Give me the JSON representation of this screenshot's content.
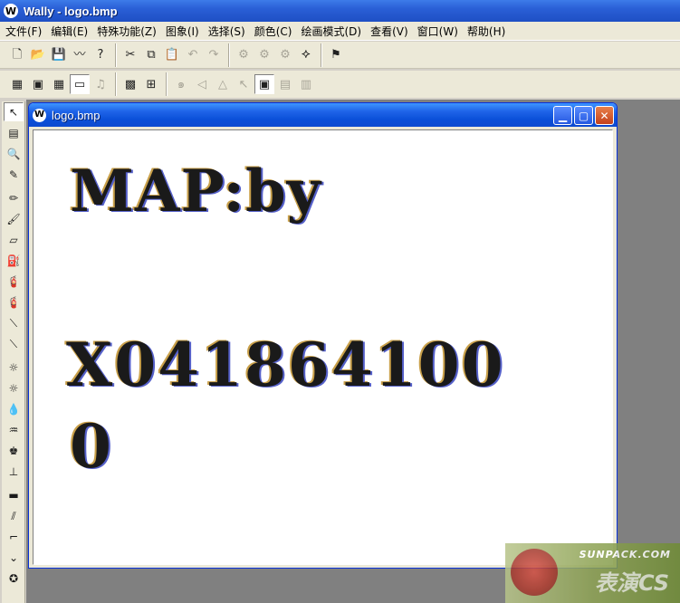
{
  "window": {
    "title": "Wally - logo.bmp",
    "app_icon_glyph": "W"
  },
  "menu": [
    {
      "label": "文件(F)"
    },
    {
      "label": "编辑(E)"
    },
    {
      "label": "特殊功能(Z)"
    },
    {
      "label": "图象(I)"
    },
    {
      "label": "选择(S)"
    },
    {
      "label": "颜色(C)"
    },
    {
      "label": "绘画模式(D)"
    },
    {
      "label": "查看(V)"
    },
    {
      "label": "窗口(W)"
    },
    {
      "label": "帮助(H)"
    }
  ],
  "toolbar1": {
    "icons": [
      "new-file-icon",
      "open-folder-icon",
      "save-disk-icon",
      "wand-icon",
      "help-icon",
      "cut-icon",
      "copy-icon",
      "paste-icon",
      "undo-icon",
      "redo-icon",
      "entity-icon",
      "entity2-icon",
      "entity3-icon",
      "decal-icon",
      "compile-icon"
    ],
    "glyphs": [
      "🗋",
      "📂",
      "💾",
      "〰",
      "?",
      "✂",
      "⧉",
      "📋",
      "↶",
      "↷",
      "⚙",
      "⚙",
      "⚙",
      "⯎",
      "⚑"
    ]
  },
  "toolbar2": {
    "icons": [
      "palette-icon",
      "image-icon",
      "grid-icon",
      "tile-icon",
      "music-icon",
      "grid-dense-icon",
      "grid-quad-icon",
      "spiral-icon",
      "triangle-left-icon",
      "triangle-icon",
      "arrow-icon",
      "layout1-icon",
      "layout2-icon",
      "layout3-icon"
    ],
    "glyphs": [
      "▦",
      "▣",
      "▦",
      "▭",
      "♫",
      "▩",
      "⊞",
      "๑",
      "◁",
      "△",
      "↖",
      "▣",
      "▤",
      "▥"
    ]
  },
  "tools": {
    "icons": [
      "pointer-icon",
      "ruler-icon",
      "zoom-icon",
      "eyedropper-icon",
      "pencil-icon",
      "brush-icon",
      "eraser-icon",
      "fill-icon",
      "spray-icon",
      "spray2-icon",
      "line-icon",
      "line2-icon",
      "sun-icon",
      "sun2-icon",
      "drop-icon",
      "stamp-icon",
      "people-icon",
      "plunger-icon",
      "hazard-icon",
      "slash-icon",
      "gun-icon",
      "chevron-down-icon",
      "emblem-icon"
    ],
    "glyphs": [
      "↖",
      "▤",
      "🔍",
      "✎",
      "✏",
      "🖌",
      "▱",
      "⛽",
      "🧯",
      "🧯",
      "⟍",
      "⟍",
      "☼",
      "☼",
      "💧",
      "♒",
      "♚",
      "⊥",
      "▬",
      "⫽",
      "⌐",
      "⌄",
      "✪"
    ]
  },
  "document": {
    "title": "logo.bmp",
    "lines": [
      "MAP:by",
      "X041864100",
      "0"
    ]
  },
  "watermark": {
    "site": "SUNPACK.COM",
    "brand": "表演CS"
  },
  "colors": {
    "titlebar": "#2a5fd6",
    "mdi_background": "#808080",
    "canvas": "#ffffff",
    "chrome": "#ece9d8"
  }
}
